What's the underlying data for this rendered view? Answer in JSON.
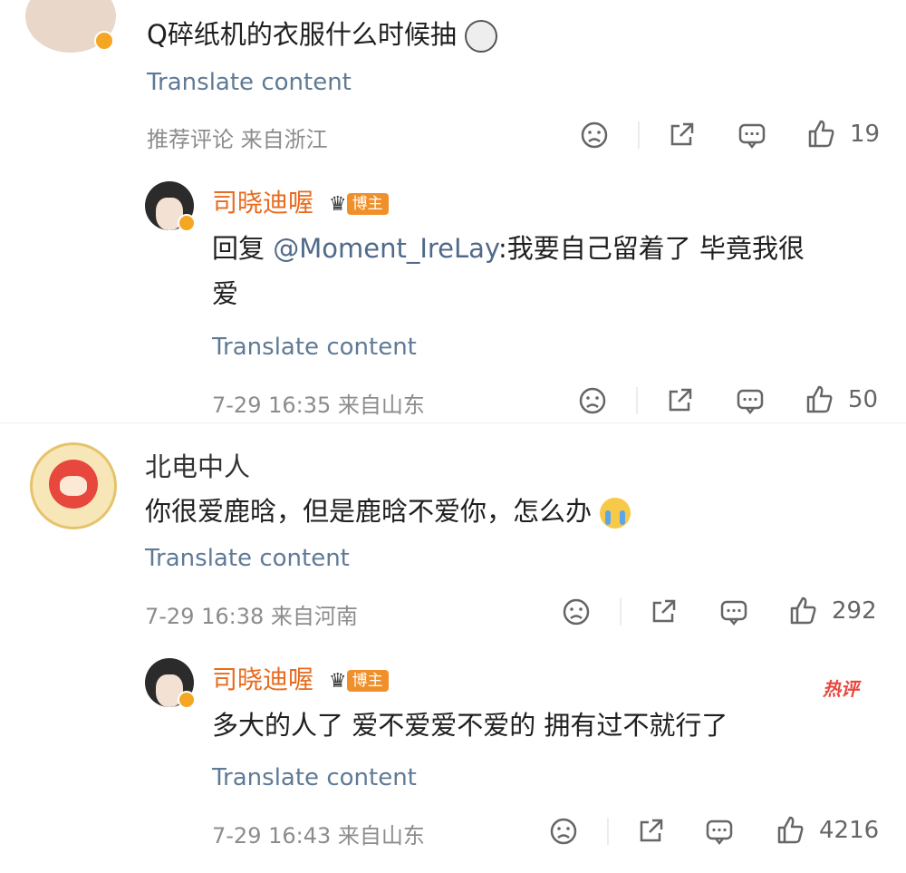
{
  "comment1": {
    "text": "Q碎纸机的衣服什么时候抽",
    "translate": "Translate content",
    "meta": "推荐评论 来自浙江",
    "likes": "19"
  },
  "reply1": {
    "author": "司晓迪喔",
    "badge": "博主",
    "text_prefix": "回复 ",
    "mention": "@Moment_IreLay",
    "text_line1": ":我要自己留着了 毕竟我很",
    "text_line2": "爱",
    "translate": "Translate content",
    "meta": "7-29 16:35 来自山东",
    "likes": "50"
  },
  "comment2": {
    "author": "北电中人",
    "text": "你很爱鹿晗，但是鹿晗不爱你，怎么办",
    "translate": "Translate content",
    "meta": "7-29 16:38 来自河南",
    "likes": "292"
  },
  "reply2": {
    "author": "司晓迪喔",
    "badge": "博主",
    "hot_label": "热评",
    "text": "多大的人了 爱不爱爱不爱的 拥有过不就行了",
    "translate": "Translate content",
    "meta": "7-29 16:43 来自山东",
    "likes": "4216"
  },
  "colors": {
    "accent_orange": "#e86b1f",
    "link_blue": "#5f7a95",
    "meta_gray": "#8c8c8c"
  }
}
